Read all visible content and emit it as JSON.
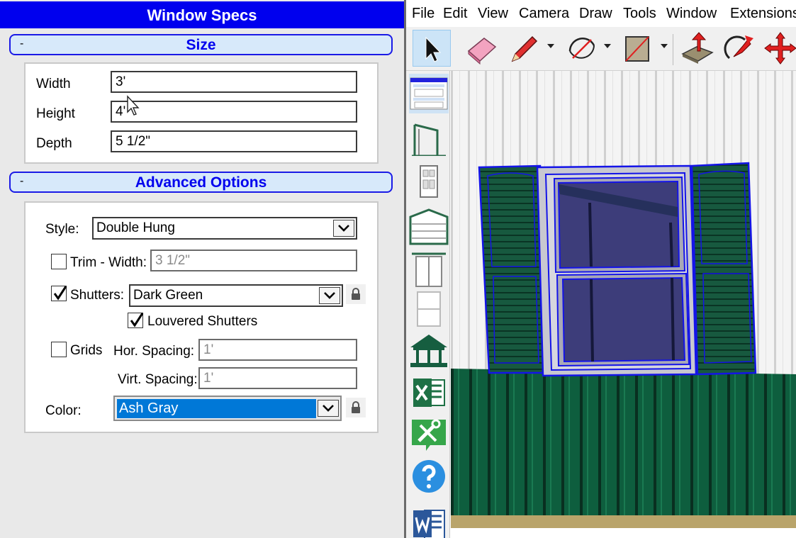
{
  "panel": {
    "title": "Window Specs",
    "size_section": {
      "toggle": "-",
      "title": "Size",
      "width_label": "Width",
      "width_value": "3'",
      "height_label": "Height",
      "height_value": "4'",
      "depth_label": "Depth",
      "depth_value": "5 1/2\""
    },
    "advanced_section": {
      "toggle": "-",
      "title": "Advanced Options",
      "style_label": "Style:",
      "style_value": "Double Hung",
      "trim_label": "Trim - Width:",
      "trim_checked": false,
      "trim_value": "3 1/2\"",
      "shutters_label": "Shutters:",
      "shutters_checked": true,
      "shutters_value": "Dark Green",
      "louvered_label": "Louvered Shutters",
      "louvered_checked": true,
      "grids_label": "Grids",
      "grids_checked": false,
      "hor_spacing_label": "Hor. Spacing:",
      "hor_spacing_value": "1'",
      "virt_spacing_label": "Virt. Spacing:",
      "virt_spacing_value": "1'",
      "color_label": "Color:",
      "color_value": "Ash Gray"
    }
  },
  "menubar": {
    "items": [
      "File",
      "Edit",
      "View",
      "Camera",
      "Draw",
      "Tools",
      "Window",
      "Extensions"
    ]
  },
  "colors": {
    "title_blue": "#0000ee",
    "section_bg": "#d7e9fa",
    "selection_blue": "#0078d7",
    "siding_green": "#0e5e3e",
    "shutter_green": "#17593f",
    "selection_outline": "#1414e8"
  }
}
